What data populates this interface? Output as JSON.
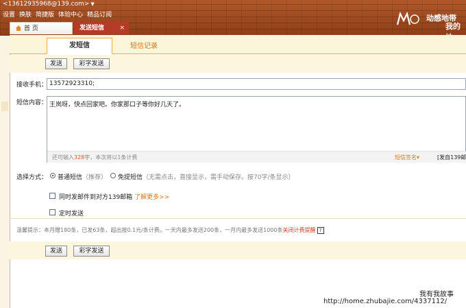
{
  "header": {
    "account": "<13612935968@139.com>",
    "nav": [
      "设置",
      "换肤",
      "简捷版",
      "体验中心",
      "精品订阅"
    ],
    "slogan_line1": "动感地带",
    "slogan_line2": "我的地"
  },
  "tabs": {
    "home": "首 页",
    "sms": "发送短信",
    "close": "×"
  },
  "subtabs": {
    "send": "发短信",
    "record": "短信记录"
  },
  "toolbar": {
    "send": "发送",
    "mms": "彩字发送"
  },
  "form": {
    "recipient_label": "接收手机：",
    "recipient_value": "13572923310;",
    "content_label": "短信内容：",
    "content_value": "王岚呀，快点回家吧。你家那口子等你好几天了。",
    "count_prefix": "还可输入",
    "count_value": "328",
    "count_suffix": "字，本次将以1条计费",
    "signature": "短信签名▾",
    "send_from": "[发自139邮",
    "method_label": "选择方式：",
    "method_normal": "普通短信",
    "method_normal_note": "（推荐）",
    "method_free": "免提短信",
    "method_free_note": "（无需点击，直接显示，需手动保存。按70字/条显示）",
    "option_email": "同时发邮件到对方139邮箱",
    "learn_more": "了解更多>>",
    "option_timed": "定时发送"
  },
  "tips": {
    "text": "温馨提示：本月赠180条，已发63条，超出按0.1元/条计费。一天内最多发送200条，一月内最多发送1000条",
    "link": "关闭计费提醒"
  },
  "watermark": {
    "line1": "我有我故事",
    "line2": "http://home.zhubajie.com/4337112/"
  }
}
